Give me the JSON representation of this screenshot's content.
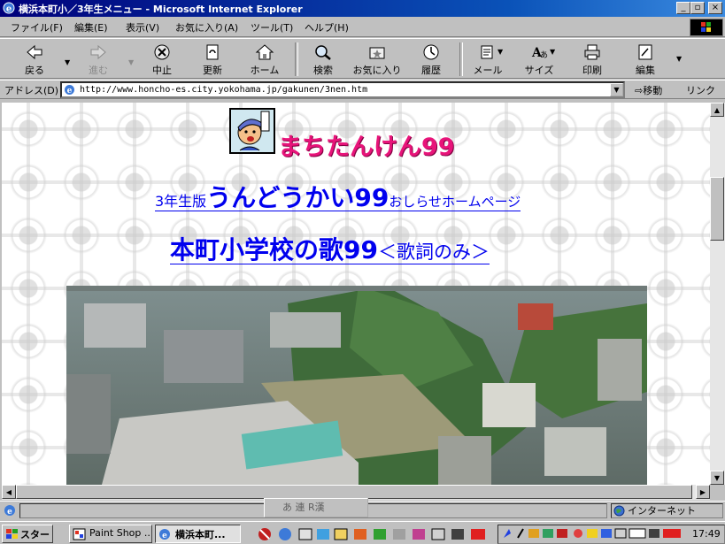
{
  "window": {
    "title": "横浜本町小／3年生メニュー - Microsoft Internet Explorer",
    "min_label": "_",
    "max_label": "▫",
    "close_label": "×"
  },
  "menu": [
    "ファイル(F)",
    "編集(E)",
    "表示(V)",
    "お気に入り(A)",
    "ツール(T)",
    "ヘルプ(H)"
  ],
  "toolbar": {
    "back": "戻る",
    "forward": "進む",
    "stop": "中止",
    "refresh": "更新",
    "home": "ホーム",
    "search": "検索",
    "favorites": "お気に入り",
    "history": "履歴",
    "mail": "メール",
    "size": "サイズ",
    "print": "印刷",
    "edit": "編集"
  },
  "address": {
    "label": "アドレス(D)",
    "url": "http://www.honcho-es.city.yokohama.jp/gakunen/3nen.htm",
    "go": "移動",
    "links": "リンク"
  },
  "page": {
    "site_title": "まちたんけん99",
    "link1_prefix": "3年生版",
    "link1_main": "うんどうかい99",
    "link1_suffix": "おしらせホームページ",
    "link2_main": "本町小学校の歌99",
    "link2_suffix": "＜歌詞のみ＞"
  },
  "status": {
    "ime": "あ 連 R漢",
    "zone": "インターネット"
  },
  "taskbar": {
    "start": "スタート",
    "task1": "Paint Shop ...",
    "task2": "横浜本町...",
    "clock": "17:49"
  },
  "colors": {
    "title_pink": "#e8147a",
    "link_blue": "#0000ee",
    "titlebar": "#00007b"
  }
}
